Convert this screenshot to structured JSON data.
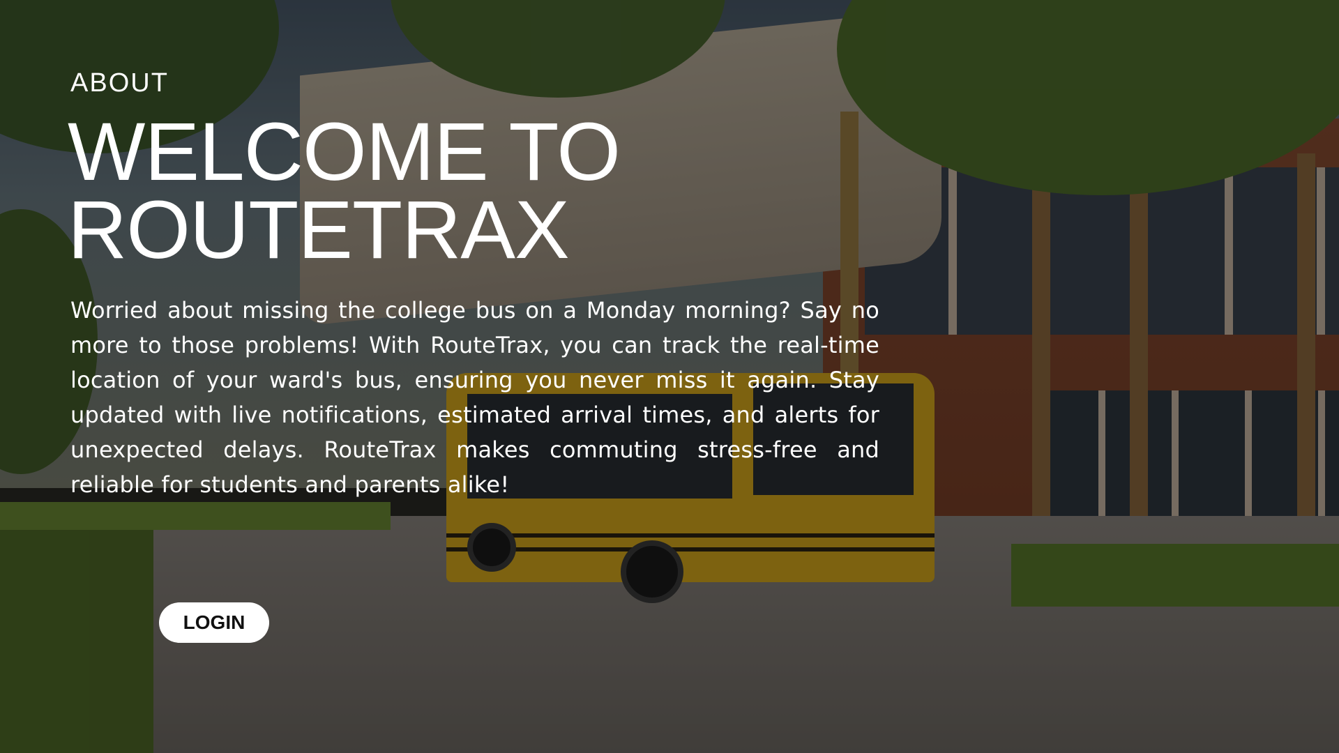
{
  "hero": {
    "section_label": "ABOUT",
    "headline_line1": "WELCOME TO",
    "headline_line2": "ROUTETRAX",
    "description": "Worried about missing the college bus on a Monday morning? Say no more to those problems! With RouteTrax, you can track the real-time location of your ward's bus, ensuring you never miss it again. Stay updated with live notifications, estimated arrival times, and alerts for unexpected delays. RouteTrax makes commuting stress-free and reliable for students and parents alike!",
    "login_label": "LOGIN"
  },
  "colors": {
    "text": "#ffffff",
    "button_bg": "#ffffff",
    "button_text": "#111111",
    "overlay": "rgba(0,0,0,0.42)"
  }
}
